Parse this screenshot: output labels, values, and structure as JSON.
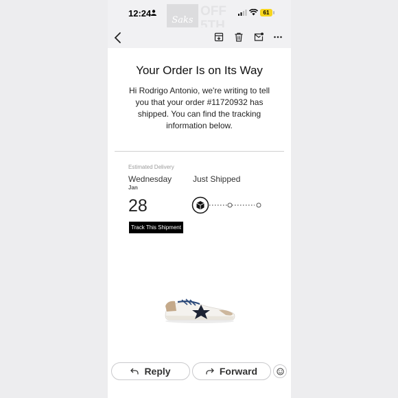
{
  "status_bar": {
    "time": "12:24",
    "battery_level": "61",
    "brand_logo_text": "Saks",
    "brand_off_text": "OFF 5TH"
  },
  "toolbar": {
    "icons": [
      "chevron-left-icon",
      "archive-icon",
      "trash-icon",
      "mark-unread-icon",
      "more-icon"
    ]
  },
  "email": {
    "title": "Your Order Is on Its Way",
    "intro_prefix": "Hi Rodrigo Antonio, we're writing to tell you that your order ",
    "order_number": "#11720932",
    "intro_suffix": " has shipped. You can find the tracking information below.",
    "estimated_delivery_label": "Estimated Delivery",
    "delivery_day": "Wednesday",
    "delivery_month": "Jan",
    "delivery_date": "28",
    "shipment_status": "Just Shipped",
    "track_button_label": "Track This Shipment",
    "progress_steps_total": 3,
    "progress_current_step": 1
  },
  "actions": {
    "reply_label": "Reply",
    "forward_label": "Forward"
  },
  "colors": {
    "accent_battery": "#f7d51d",
    "button_black": "#000000",
    "chrome_gray": "#f1f1f3"
  }
}
